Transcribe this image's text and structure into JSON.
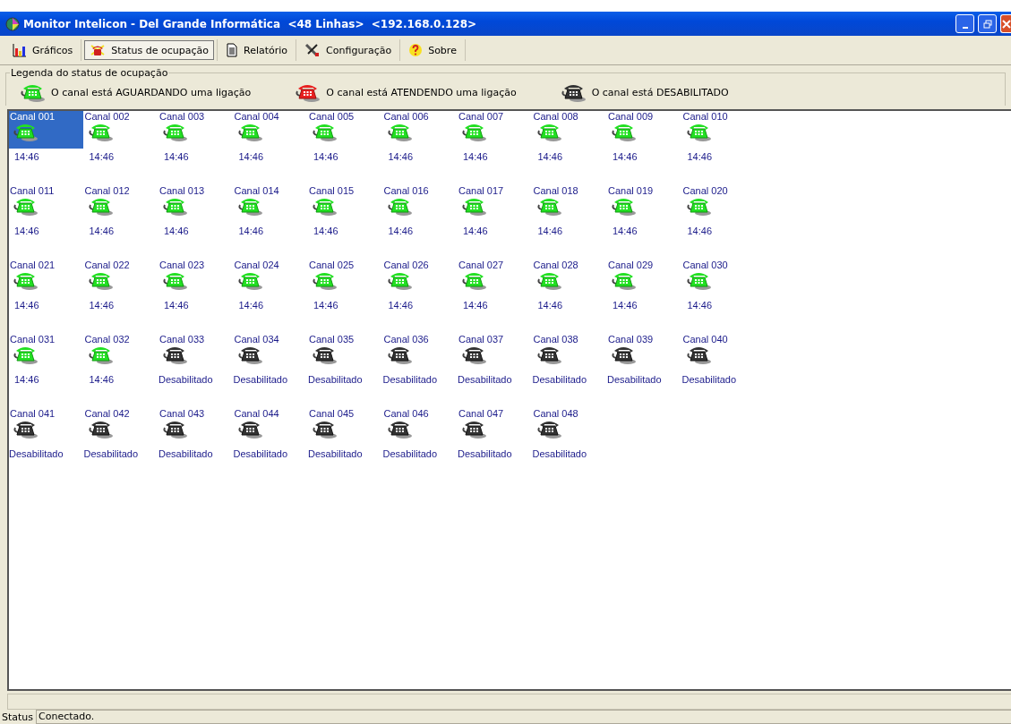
{
  "window": {
    "title": "Monitor Intelicon - Del Grande Informática  <48 Linhas>  <192.168.0.128>"
  },
  "toolbar": [
    {
      "label": "Gráficos",
      "kind": "chart",
      "selected": false
    },
    {
      "label": "Status de ocupação",
      "kind": "phone",
      "selected": true
    },
    {
      "label": "Relatório",
      "kind": "report",
      "selected": false
    },
    {
      "label": "Configuração",
      "kind": "tools",
      "selected": false
    },
    {
      "label": "Sobre",
      "kind": "help",
      "selected": false
    }
  ],
  "legend": {
    "title": "Legenda do status de ocupação",
    "items": [
      {
        "kind": "waiting",
        "label": "O canal está AGUARDANDO uma ligação"
      },
      {
        "kind": "answering",
        "label": "O canal está ATENDENDO uma ligação"
      },
      {
        "kind": "disabled",
        "label": "O canal está DESABILITADO"
      }
    ]
  },
  "channels": [
    {
      "name": "Canal 001",
      "kind": "waiting",
      "status": "14:46",
      "selected": true
    },
    {
      "name": "Canal 002",
      "kind": "waiting",
      "status": "14:46",
      "selected": false
    },
    {
      "name": "Canal 003",
      "kind": "waiting",
      "status": "14:46",
      "selected": false
    },
    {
      "name": "Canal 004",
      "kind": "waiting",
      "status": "14:46",
      "selected": false
    },
    {
      "name": "Canal 005",
      "kind": "waiting",
      "status": "14:46",
      "selected": false
    },
    {
      "name": "Canal 006",
      "kind": "waiting",
      "status": "14:46",
      "selected": false
    },
    {
      "name": "Canal 007",
      "kind": "waiting",
      "status": "14:46",
      "selected": false
    },
    {
      "name": "Canal 008",
      "kind": "waiting",
      "status": "14:46",
      "selected": false
    },
    {
      "name": "Canal 009",
      "kind": "waiting",
      "status": "14:46",
      "selected": false
    },
    {
      "name": "Canal 010",
      "kind": "waiting",
      "status": "14:46",
      "selected": false
    },
    {
      "name": "Canal 011",
      "kind": "waiting",
      "status": "14:46",
      "selected": false
    },
    {
      "name": "Canal 012",
      "kind": "waiting",
      "status": "14:46",
      "selected": false
    },
    {
      "name": "Canal 013",
      "kind": "waiting",
      "status": "14:46",
      "selected": false
    },
    {
      "name": "Canal 014",
      "kind": "waiting",
      "status": "14:46",
      "selected": false
    },
    {
      "name": "Canal 015",
      "kind": "waiting",
      "status": "14:46",
      "selected": false
    },
    {
      "name": "Canal 016",
      "kind": "waiting",
      "status": "14:46",
      "selected": false
    },
    {
      "name": "Canal 017",
      "kind": "waiting",
      "status": "14:46",
      "selected": false
    },
    {
      "name": "Canal 018",
      "kind": "waiting",
      "status": "14:46",
      "selected": false
    },
    {
      "name": "Canal 019",
      "kind": "waiting",
      "status": "14:46",
      "selected": false
    },
    {
      "name": "Canal 020",
      "kind": "waiting",
      "status": "14:46",
      "selected": false
    },
    {
      "name": "Canal 021",
      "kind": "waiting",
      "status": "14:46",
      "selected": false
    },
    {
      "name": "Canal 022",
      "kind": "waiting",
      "status": "14:46",
      "selected": false
    },
    {
      "name": "Canal 023",
      "kind": "waiting",
      "status": "14:46",
      "selected": false
    },
    {
      "name": "Canal 024",
      "kind": "waiting",
      "status": "14:46",
      "selected": false
    },
    {
      "name": "Canal 025",
      "kind": "waiting",
      "status": "14:46",
      "selected": false
    },
    {
      "name": "Canal 026",
      "kind": "waiting",
      "status": "14:46",
      "selected": false
    },
    {
      "name": "Canal 027",
      "kind": "waiting",
      "status": "14:46",
      "selected": false
    },
    {
      "name": "Canal 028",
      "kind": "waiting",
      "status": "14:46",
      "selected": false
    },
    {
      "name": "Canal 029",
      "kind": "waiting",
      "status": "14:46",
      "selected": false
    },
    {
      "name": "Canal 030",
      "kind": "waiting",
      "status": "14:46",
      "selected": false
    },
    {
      "name": "Canal 031",
      "kind": "waiting",
      "status": "14:46",
      "selected": false
    },
    {
      "name": "Canal 032",
      "kind": "waiting",
      "status": "14:46",
      "selected": false
    },
    {
      "name": "Canal 033",
      "kind": "disabled",
      "status": "Desabilitado",
      "selected": false
    },
    {
      "name": "Canal 034",
      "kind": "disabled",
      "status": "Desabilitado",
      "selected": false
    },
    {
      "name": "Canal 035",
      "kind": "disabled",
      "status": "Desabilitado",
      "selected": false
    },
    {
      "name": "Canal 036",
      "kind": "disabled",
      "status": "Desabilitado",
      "selected": false
    },
    {
      "name": "Canal 037",
      "kind": "disabled",
      "status": "Desabilitado",
      "selected": false
    },
    {
      "name": "Canal 038",
      "kind": "disabled",
      "status": "Desabilitado",
      "selected": false
    },
    {
      "name": "Canal 039",
      "kind": "disabled",
      "status": "Desabilitado",
      "selected": false
    },
    {
      "name": "Canal 040",
      "kind": "disabled",
      "status": "Desabilitado",
      "selected": false
    },
    {
      "name": "Canal 041",
      "kind": "disabled",
      "status": "Desabilitado",
      "selected": false
    },
    {
      "name": "Canal 042",
      "kind": "disabled",
      "status": "Desabilitado",
      "selected": false
    },
    {
      "name": "Canal 043",
      "kind": "disabled",
      "status": "Desabilitado",
      "selected": false
    },
    {
      "name": "Canal 044",
      "kind": "disabled",
      "status": "Desabilitado",
      "selected": false
    },
    {
      "name": "Canal 045",
      "kind": "disabled",
      "status": "Desabilitado",
      "selected": false
    },
    {
      "name": "Canal 046",
      "kind": "disabled",
      "status": "Desabilitado",
      "selected": false
    },
    {
      "name": "Canal 047",
      "kind": "disabled",
      "status": "Desabilitado",
      "selected": false
    },
    {
      "name": "Canal 048",
      "kind": "disabled",
      "status": "Desabilitado",
      "selected": false
    }
  ],
  "status_bar": {
    "label": "Status",
    "value": "Conectado."
  }
}
